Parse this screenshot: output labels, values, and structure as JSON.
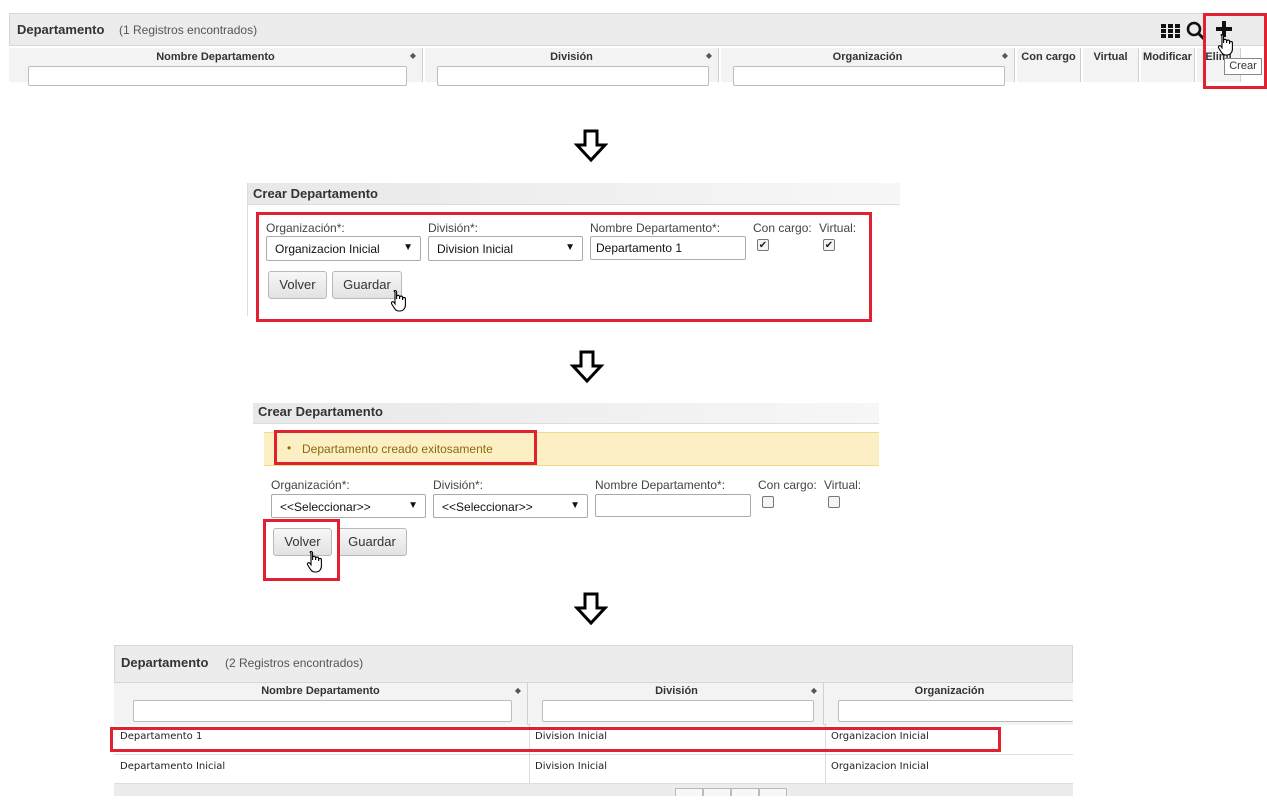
{
  "list1": {
    "title": "Departamento",
    "count": "(1 Registros encontrados)",
    "columns": [
      "Nombre Departamento",
      "División",
      "Organización",
      "Con cargo",
      "Virtual",
      "Modificar",
      "Elimi"
    ],
    "tooltip": "Crear",
    "icons": [
      "grid-icon",
      "search-icon",
      "plus-icon"
    ]
  },
  "form1": {
    "title": "Crear Departamento",
    "org_label": "Organización*:",
    "org_value": "Organizacion Inicial",
    "div_label": "División*:",
    "div_value": "Division Inicial",
    "name_label": "Nombre Departamento*:",
    "name_value": "Departamento 1",
    "cargo_label": "Con cargo:",
    "cargo_checked": true,
    "virtual_label": "Virtual:",
    "virtual_checked": true,
    "back_label": "Volver",
    "save_label": "Guardar"
  },
  "form2": {
    "title": "Crear Departamento",
    "message": "Departamento creado exitosamente",
    "org_label": "Organización*:",
    "org_value": "<<Seleccionar>>",
    "div_label": "División*:",
    "div_value": "<<Seleccionar>>",
    "name_label": "Nombre Departamento*:",
    "name_value": "",
    "cargo_label": "Con cargo:",
    "cargo_checked": false,
    "virtual_label": "Virtual:",
    "virtual_checked": false,
    "back_label": "Volver",
    "save_label": "Guardar"
  },
  "list2": {
    "title": "Departamento",
    "count": "(2 Registros encontrados)",
    "columns": [
      "Nombre Departamento",
      "División",
      "Organización"
    ],
    "rows": [
      [
        "Departamento 1",
        "Division Inicial",
        "Organizacion Inicial"
      ],
      [
        "Departamento Inicial",
        "Division Inicial",
        "Organizacion Inicial"
      ]
    ]
  },
  "colors": {
    "highlight": "#e0212f",
    "message_bg": "#fcefc4",
    "message_text": "#8a6a0a"
  }
}
